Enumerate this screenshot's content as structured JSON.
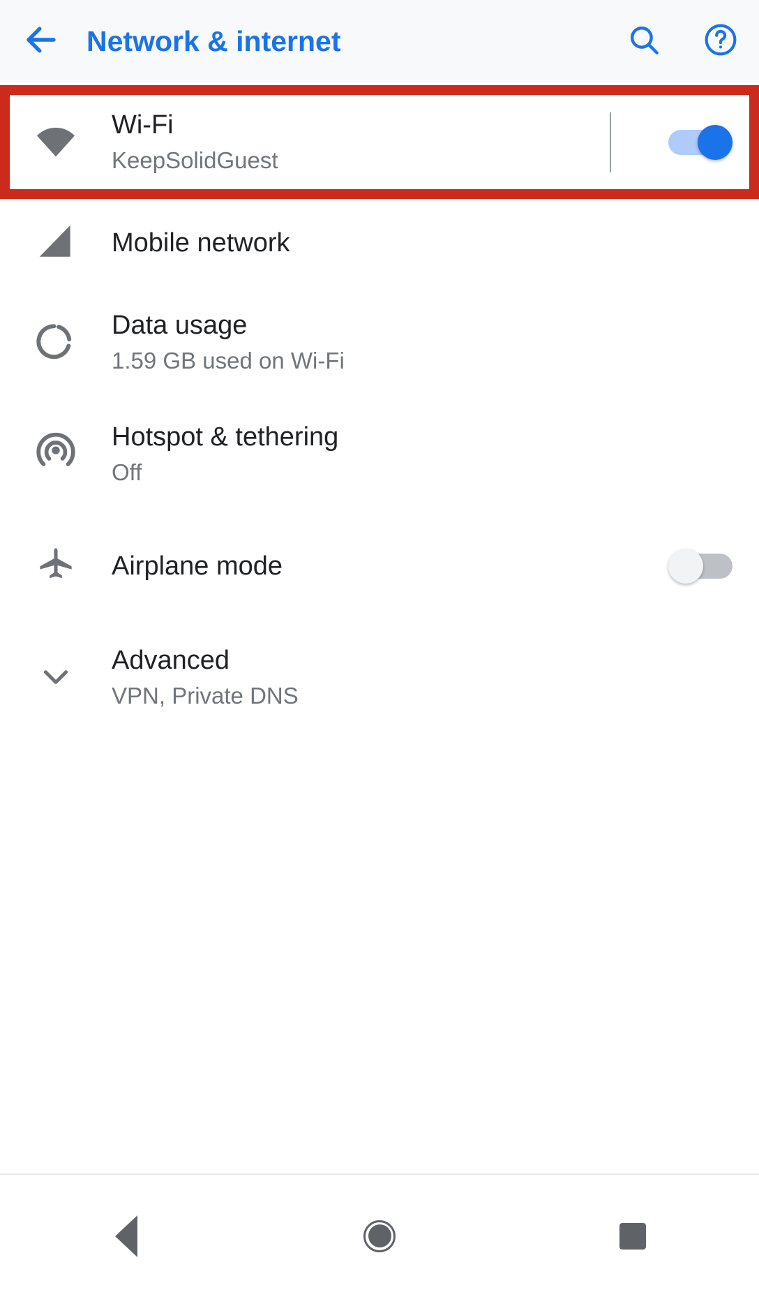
{
  "appbar": {
    "title": "Network & internet",
    "back_icon": "arrow-left-icon",
    "search_icon": "search-icon",
    "help_icon": "help-circle-icon",
    "accent_color": "#1a73e8",
    "background_color": "#f8f9fa"
  },
  "highlight": {
    "color": "#cc2a1c",
    "target": "wifi-row"
  },
  "settings_rows": [
    {
      "id": "wifi",
      "icon": "wifi-icon",
      "title": "Wi-Fi",
      "subtitle": "KeepSolidGuest",
      "has_switch": true,
      "switch_state": "on",
      "has_vertical_divider": true
    },
    {
      "id": "mobile-network",
      "icon": "signal-cellular-icon",
      "title": "Mobile network",
      "subtitle": "",
      "has_switch": false
    },
    {
      "id": "data-usage",
      "icon": "data-usage-icon",
      "title": "Data usage",
      "subtitle": "1.59 GB used on Wi-Fi",
      "has_switch": false
    },
    {
      "id": "hotspot-tethering",
      "icon": "hotspot-icon",
      "title": "Hotspot & tethering",
      "subtitle": "Off",
      "has_switch": false
    },
    {
      "id": "airplane-mode",
      "icon": "airplane-icon",
      "title": "Airplane mode",
      "subtitle": "",
      "has_switch": true,
      "switch_state": "off"
    },
    {
      "id": "advanced",
      "icon": "chevron-down-icon",
      "title": "Advanced",
      "subtitle": "VPN, Private DNS",
      "has_switch": false
    }
  ],
  "navbar": {
    "back_icon": "triangle-back-icon",
    "home_icon": "circle-home-icon",
    "recents_icon": "square-recents-icon",
    "icon_color": "#5f6368"
  },
  "colors": {
    "switch_on_track": "#aecbfa",
    "switch_on_thumb": "#1a73e8",
    "switch_off_track": "#bdc1c6",
    "switch_off_thumb": "#f1f3f4",
    "icon_gray": "#5f6368",
    "title_text": "#202124",
    "subtitle_text": "#70757a"
  }
}
